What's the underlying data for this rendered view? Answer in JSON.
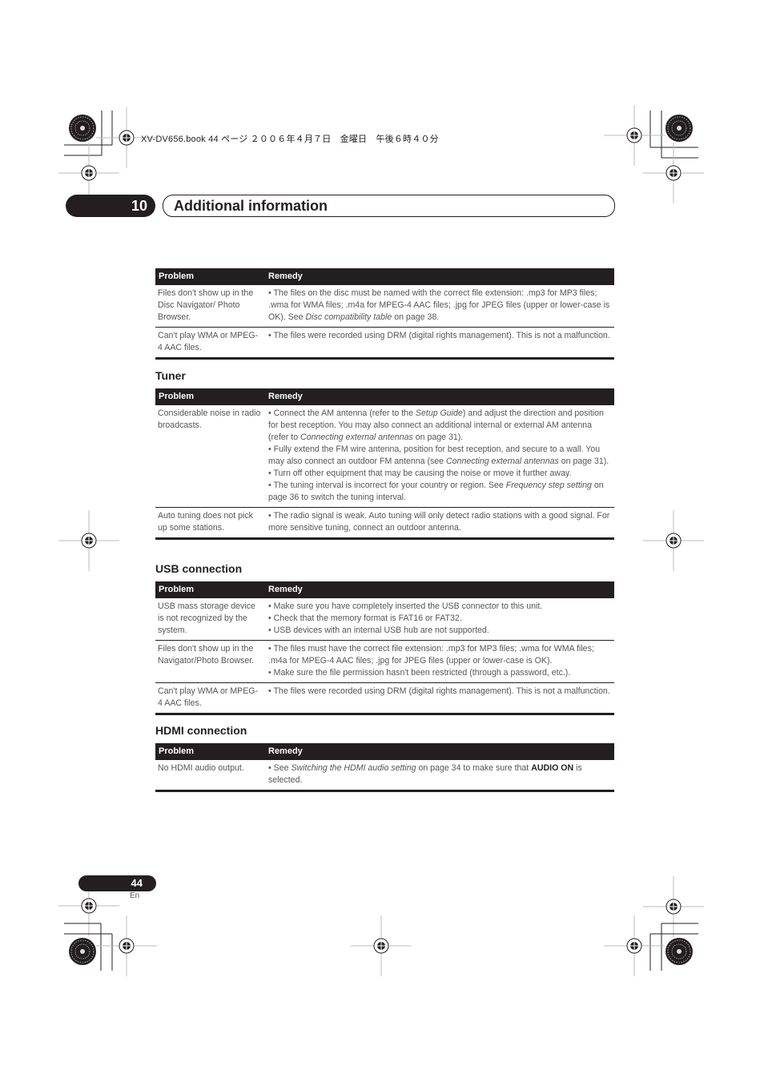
{
  "header": {
    "print_line": "XV-DV656.book  44 ページ  ２００６年４月７日　金曜日　午後６時４０分"
  },
  "chapter": {
    "number": "10",
    "title": "Additional information"
  },
  "tables": [
    {
      "section": "",
      "headers": [
        "Problem",
        "Remedy"
      ],
      "rows": [
        {
          "problem": "Files don't show up in the Disc Navigator/ Photo Browser.",
          "remedy": [
            [
              "• The files on the disc must be named with the correct file extension: .mp3 for MP3 files; .wma for WMA files; .m4a for MPEG-4 AAC files; .jpg for JPEG files (upper or lower-case is OK). See ",
              {
                "i": "Disc compatibility table"
              },
              " on page 38."
            ]
          ]
        },
        {
          "problem": "Can't play WMA or MPEG-4 AAC files.",
          "remedy": [
            [
              "• The files were recorded using DRM (digital rights management). This is not a malfunction."
            ]
          ]
        }
      ]
    },
    {
      "section": "Tuner",
      "headers": [
        "Problem",
        "Remedy"
      ],
      "rows": [
        {
          "problem": "Considerable noise in radio broadcasts.",
          "remedy": [
            [
              "• Connect the AM antenna (refer to the ",
              {
                "i": "Setup Guide"
              },
              ") and adjust the direction and position for best reception. You may also connect an additional internal or external AM antenna (refer to ",
              {
                "i": "Connecting external antennas"
              },
              " on page 31)."
            ],
            [
              "• Fully extend the FM wire antenna, position for best reception, and secure to a wall. You may also connect an outdoor FM antenna (see ",
              {
                "i": "Connecting external antennas"
              },
              " on page 31)."
            ],
            [
              "• Turn off other equipment that may be causing the noise or move it further away."
            ],
            [
              "• The tuning interval is incorrect for your country or region. See ",
              {
                "i": "Frequency step setting"
              },
              " on page 36 to switch the tuning interval."
            ]
          ]
        },
        {
          "problem": "Auto tuning does not pick up some stations.",
          "remedy": [
            [
              "• The radio signal is weak. Auto tuning will only detect radio stations with a good signal. For more sensitive tuning, connect an outdoor antenna."
            ]
          ]
        }
      ]
    },
    {
      "section": "USB connection",
      "headers": [
        "Problem",
        "Remedy"
      ],
      "rows": [
        {
          "problem": "USB mass storage device is not recognized by the system.",
          "remedy": [
            [
              "• Make sure you have completely inserted the USB connector to this unit."
            ],
            [
              "• Check that the memory format is FAT16 or FAT32."
            ],
            [
              "• USB devices with an internal USB hub are not supported."
            ]
          ]
        },
        {
          "problem": "Files don't show up in the Navigator/Photo Browser.",
          "remedy": [
            [
              "• The files must have the correct file extension: .mp3 for MP3 files; .wma for WMA files; .m4a for MPEG-4 AAC files; .jpg for JPEG files (upper or lower-case is OK)."
            ],
            [
              "• Make sure the file permission hasn't been restricted (through a password, etc.)."
            ]
          ]
        },
        {
          "problem": "Can't play WMA or MPEG-4 AAC files.",
          "remedy": [
            [
              "• The files were recorded using DRM (digital rights management). This is not a malfunction."
            ]
          ]
        }
      ]
    },
    {
      "section": "HDMI connection",
      "headers": [
        "Problem",
        "Remedy"
      ],
      "rows": [
        {
          "problem": "No HDMI audio output.",
          "remedy": [
            [
              "• See ",
              {
                "i": "Switching the HDMI audio setting"
              },
              " on page 34 to make sure that ",
              {
                "b": "AUDIO ON"
              },
              " is selected."
            ]
          ]
        }
      ]
    }
  ],
  "footer": {
    "page_number": "44",
    "language": "En"
  }
}
